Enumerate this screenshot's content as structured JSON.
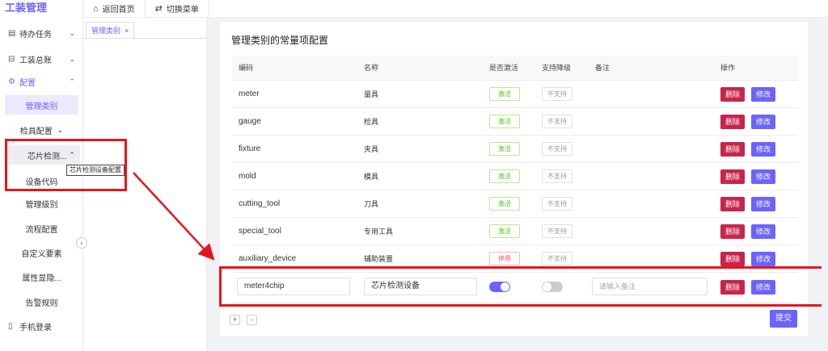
{
  "app": {
    "title": "工装管理"
  },
  "sidebar": {
    "items": [
      {
        "icon": "clipboard-icon",
        "glyph": "▤",
        "label": "待办任务"
      },
      {
        "icon": "tools-icon",
        "glyph": "⊟",
        "label": "工装总账"
      },
      {
        "icon": "gear-icon",
        "glyph": "⚙",
        "label": "配置"
      },
      {
        "label": "管理类别"
      },
      {
        "label": "检具配置"
      },
      {
        "label": "芯片检测..."
      },
      {
        "label": "设备代码"
      },
      {
        "label": "管理级别"
      },
      {
        "label": "流程配置"
      },
      {
        "label": "自定义要素"
      },
      {
        "label": "属性显隐..."
      },
      {
        "label": "告警规则"
      },
      {
        "icon": "mobile-icon",
        "glyph": "▯",
        "label": "手机登录"
      }
    ],
    "tooltip": "芯片检测设备配置"
  },
  "topbar": {
    "home_label": "返回首页",
    "switch_label": "切换菜单"
  },
  "tabs": [
    {
      "label": "管理类别",
      "close": "×"
    }
  ],
  "card": {
    "title": "管理类别的常量项配置",
    "columns": [
      "编码",
      "名称",
      "是否激活",
      "支持降级",
      "备注",
      "操作"
    ],
    "rows": [
      {
        "code": "meter",
        "name": "量具",
        "active": "激活",
        "active_state": "on",
        "degrade": "不支持"
      },
      {
        "code": "gauge",
        "name": "检具",
        "active": "激活",
        "active_state": "on",
        "degrade": "不支持"
      },
      {
        "code": "fixture",
        "name": "夹具",
        "active": "激活",
        "active_state": "on",
        "degrade": "不支持"
      },
      {
        "code": "mold",
        "name": "模具",
        "active": "激活",
        "active_state": "on",
        "degrade": "不支持"
      },
      {
        "code": "cutting_tool",
        "name": "刀具",
        "active": "激活",
        "active_state": "on",
        "degrade": "不支持"
      },
      {
        "code": "special_tool",
        "name": "专用工具",
        "active": "激活",
        "active_state": "on",
        "degrade": "不支持"
      },
      {
        "code": "auxiliary_device",
        "name": "辅助装置",
        "active": "停用",
        "active_state": "off",
        "degrade": "不支持"
      }
    ],
    "edit_row": {
      "code": "meter4chip",
      "name": "芯片检测设备",
      "active_on": true,
      "degrade_on": false,
      "remark_placeholder": "请输入备注"
    },
    "delete_label": "删除",
    "edit_label": "修改",
    "add_label": "+",
    "remove_label": "-",
    "submit_label": "提交"
  },
  "colors": {
    "accent": "#6c63ff",
    "danger": "#c8254d",
    "annotation": "#e6161a"
  }
}
